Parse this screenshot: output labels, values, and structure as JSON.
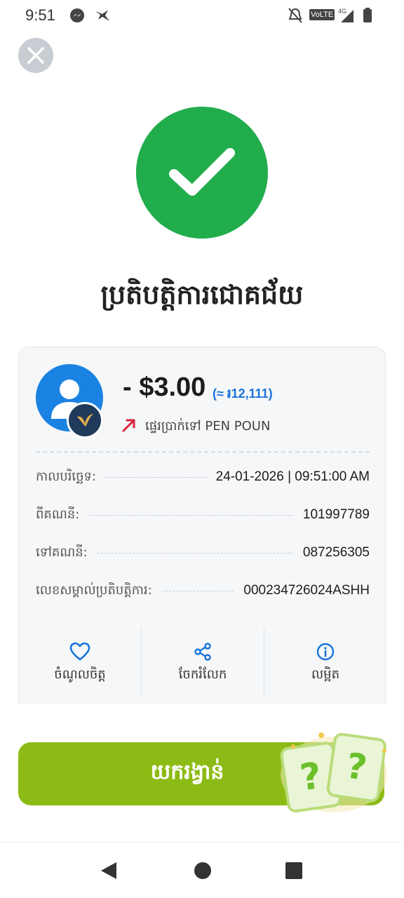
{
  "status_bar": {
    "time": "9:51",
    "icons": [
      "messenger-icon",
      "bird-icon",
      "bell-off-icon",
      "volte-icon",
      "signal-icon",
      "battery-icon"
    ],
    "network_label": "VoLTE",
    "network_gen": "4G"
  },
  "close": {
    "icon": "close-icon"
  },
  "success": {
    "icon": "checkmark-icon",
    "color": "#22ad4d"
  },
  "headline": "ប្រតិបត្តិការជោគជ័យ",
  "transaction": {
    "amount": "- $3.00",
    "amount_khr": "(≈ ៛12,111)",
    "transfer_label": "ផ្ទេរប្រាក់ទៅ PEN POUN",
    "details": [
      {
        "label": "កាលបរិច្ឆេទ:",
        "value": "24-01-2026 | 09:51:00 AM"
      },
      {
        "label": "ពីគណនី:",
        "value": "101997789"
      },
      {
        "label": "ទៅគណនី:",
        "value": "087256305"
      },
      {
        "label": "លេខសម្គាល់ប្រតិបត្តិការ:",
        "value": "000234726024ASHH"
      }
    ],
    "actions": [
      {
        "label": "ចំណូលចិត្ត",
        "icon": "heart-icon"
      },
      {
        "label": "ចែករំលែក",
        "icon": "share-icon"
      },
      {
        "label": "លម្អិត",
        "icon": "info-icon"
      }
    ]
  },
  "claim_button": {
    "label": "យករង្វាន់",
    "color": "#8dbb16"
  },
  "accent_color": "#1a73d9",
  "nav": [
    "back-icon",
    "home-icon",
    "recents-icon"
  ]
}
